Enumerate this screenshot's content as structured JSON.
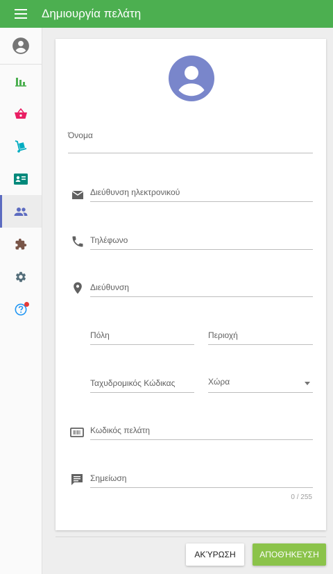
{
  "header": {
    "title": "Δημιουργία πελάτη",
    "menu_icon": "menu-icon"
  },
  "sidebar": {
    "items": [
      {
        "icon": "account-circle-icon",
        "color": "#757575"
      },
      {
        "icon": "bar-chart-icon",
        "color": "#4caf50"
      },
      {
        "icon": "shopping-basket-icon",
        "color": "#e91e63"
      },
      {
        "icon": "hand-truck-icon",
        "color": "#00acc1"
      },
      {
        "icon": "contact-card-icon",
        "color": "#00897b"
      },
      {
        "icon": "people-icon",
        "color": "#5c6bc0",
        "active": true
      },
      {
        "icon": "extension-icon",
        "color": "#795548"
      },
      {
        "icon": "gear-icon",
        "color": "#546e7a"
      },
      {
        "icon": "help-icon",
        "color": "#2196f3",
        "notification": true
      }
    ]
  },
  "form": {
    "name_label": "Όνομα",
    "email_label": "Διεύθυνση ηλεκτρονικού",
    "phone_label": "Τηλέφωνο",
    "address_label": "Διεύθυνση",
    "city_label": "Πόλη",
    "region_label": "Περιοχή",
    "postal_label": "Ταχυδρομικός Κώδικας",
    "country_label": "Χώρα",
    "customer_code_label": "Κωδικός πελάτη",
    "note_label": "Σημείωση",
    "note_counter": "0 / 255"
  },
  "actions": {
    "cancel_label": "ΑΚΎΡΩΣΗ",
    "save_label": "ΑΠΟΘΉΚΕΥΣΗ"
  },
  "colors": {
    "primary": "#4caf50",
    "accent": "#8bc34a",
    "avatar": "#7986cb"
  }
}
